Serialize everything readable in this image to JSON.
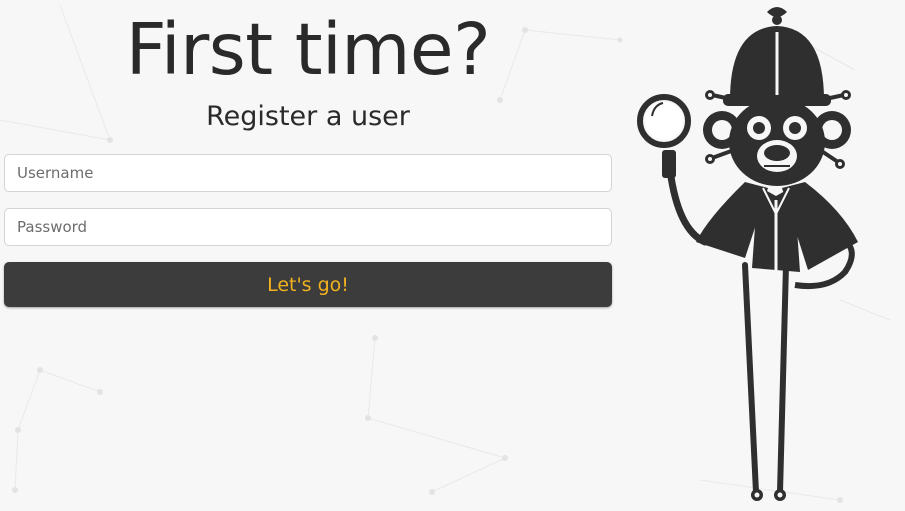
{
  "heading": {
    "title": "First time?",
    "subtitle": "Register a user"
  },
  "form": {
    "username_placeholder": "Username",
    "password_placeholder": "Password",
    "submit_label": "Let's go!"
  },
  "colors": {
    "background": "#f7f7f7",
    "button": "#3c3c3c",
    "button_text": "#f2b21f",
    "text": "#2a2a2a",
    "mascot": "#2f2f2f"
  },
  "icons": {
    "mascot": "detective-monkey-mascot"
  }
}
